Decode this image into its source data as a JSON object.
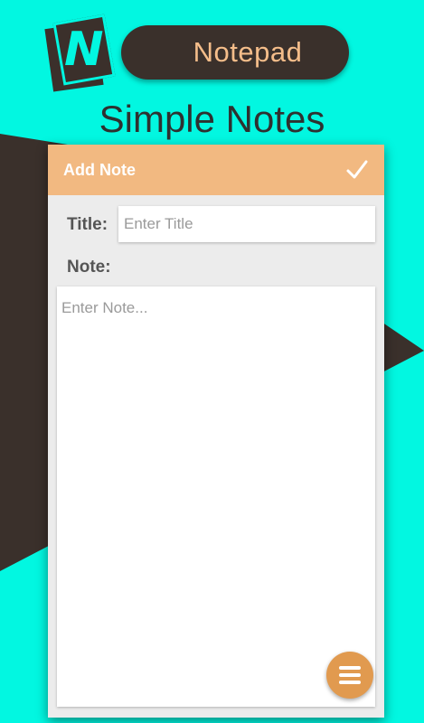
{
  "header": {
    "logo_letter": "N",
    "app_name": "Notepad",
    "tagline": "Simple Notes"
  },
  "appbar": {
    "title": "Add Note",
    "confirm_icon": "check-icon"
  },
  "form": {
    "title_label": "Title:",
    "title_placeholder": "Enter Title",
    "title_value": "",
    "note_label": "Note:",
    "note_placeholder": "Enter Note...",
    "note_value": ""
  },
  "fab": {
    "icon": "menu-icon"
  },
  "colors": {
    "background": "#02f7e1",
    "dark": "#3a302b",
    "accent": "#f2b981",
    "fab": "#e19a4f",
    "pill_text": "#f4bd8a"
  }
}
